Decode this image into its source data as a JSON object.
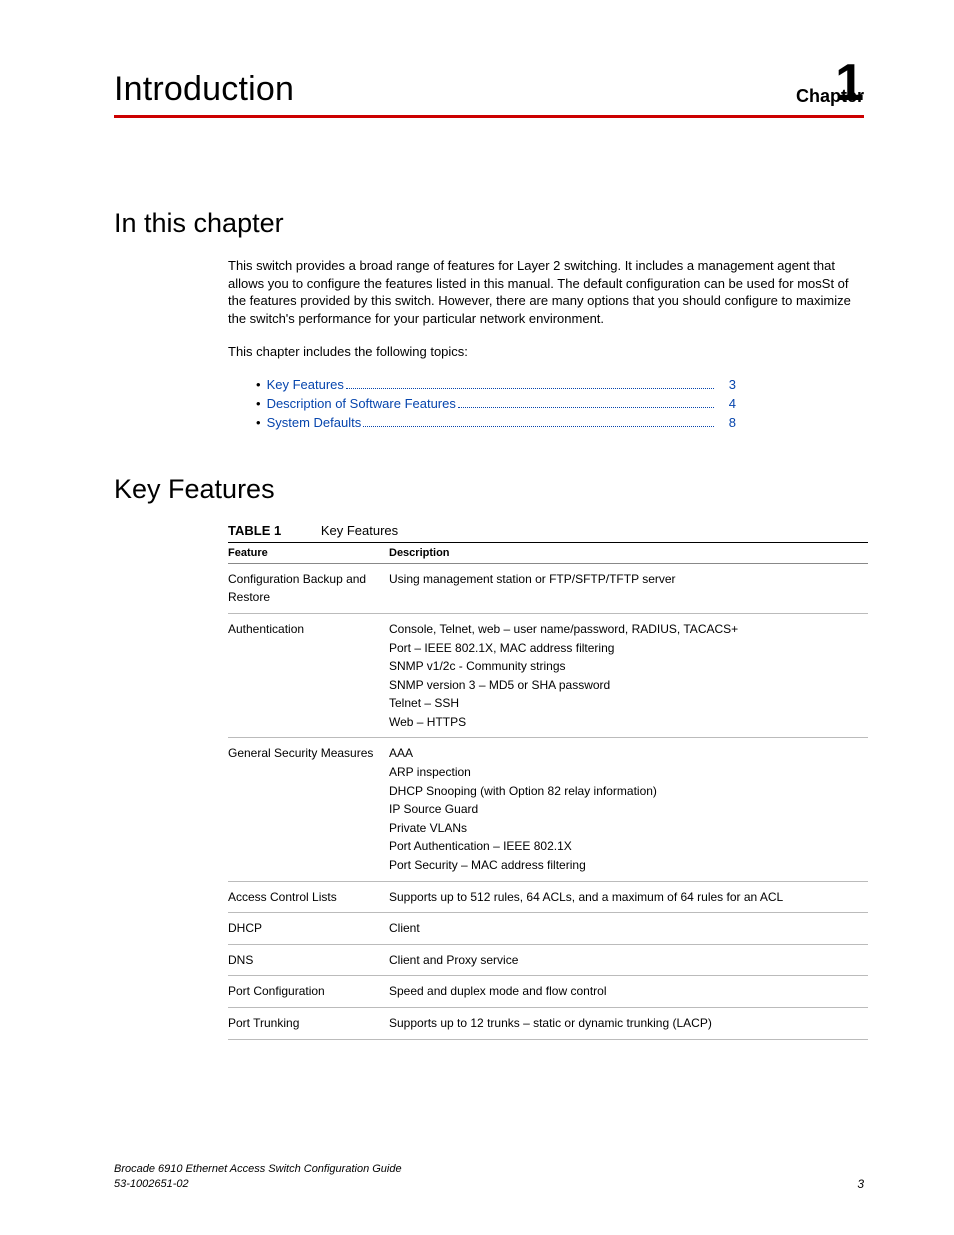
{
  "chapter": {
    "label": "Chapter",
    "number": "1",
    "title": "Introduction"
  },
  "sections": {
    "in_this_chapter": {
      "heading": "In this chapter",
      "para1": "This switch provides a broad range of features for Layer 2 switching. It includes a management agent that allows you to configure the features listed in this manual. The default configuration can be used for mosSt of the features provided by this switch. However, there are many options that you should configure to maximize the switch's performance for your particular network environment.",
      "para2": "This chapter includes the following topics:",
      "toc": [
        {
          "label": "Key Features",
          "page": "3"
        },
        {
          "label": "Description of Software Features",
          "page": "4"
        },
        {
          "label": "System Defaults",
          "page": "8"
        }
      ]
    },
    "key_features": {
      "heading": "Key Features",
      "table_caption_num": "TABLE 1",
      "table_caption_title": "Key Features",
      "columns": {
        "feature": "Feature",
        "description": "Description"
      },
      "rows": [
        {
          "feature": "Configuration Backup and Restore",
          "description": "Using management station or FTP/SFTP/TFTP server"
        },
        {
          "feature": "Authentication",
          "description": "Console, Telnet, web – user name/password, RADIUS, TACACS+\nPort – IEEE 802.1X, MAC address filtering\nSNMP v1/2c - Community strings\nSNMP version 3 – MD5 or SHA password\nTelnet – SSH\nWeb – HTTPS"
        },
        {
          "feature": "General Security Measures",
          "description": "AAA\nARP inspection\nDHCP Snooping (with Option 82 relay information)\nIP Source Guard\nPrivate VLANs\nPort Authentication – IEEE 802.1X\nPort Security – MAC address filtering"
        },
        {
          "feature": "Access Control Lists",
          "description": "Supports up to 512 rules, 64 ACLs, and a maximum of 64 rules for an ACL"
        },
        {
          "feature": "DHCP",
          "description": "Client"
        },
        {
          "feature": "DNS",
          "description": "Client and Proxy service"
        },
        {
          "feature": "Port Configuration",
          "description": "Speed and duplex mode and flow control"
        },
        {
          "feature": "Port Trunking",
          "description": "Supports up to 12 trunks – static or dynamic trunking (LACP)"
        }
      ]
    }
  },
  "footer": {
    "doc_title": "Brocade 6910 Ethernet Access Switch Configuration Guide",
    "doc_number": "53-1002651-02",
    "page": "3"
  }
}
